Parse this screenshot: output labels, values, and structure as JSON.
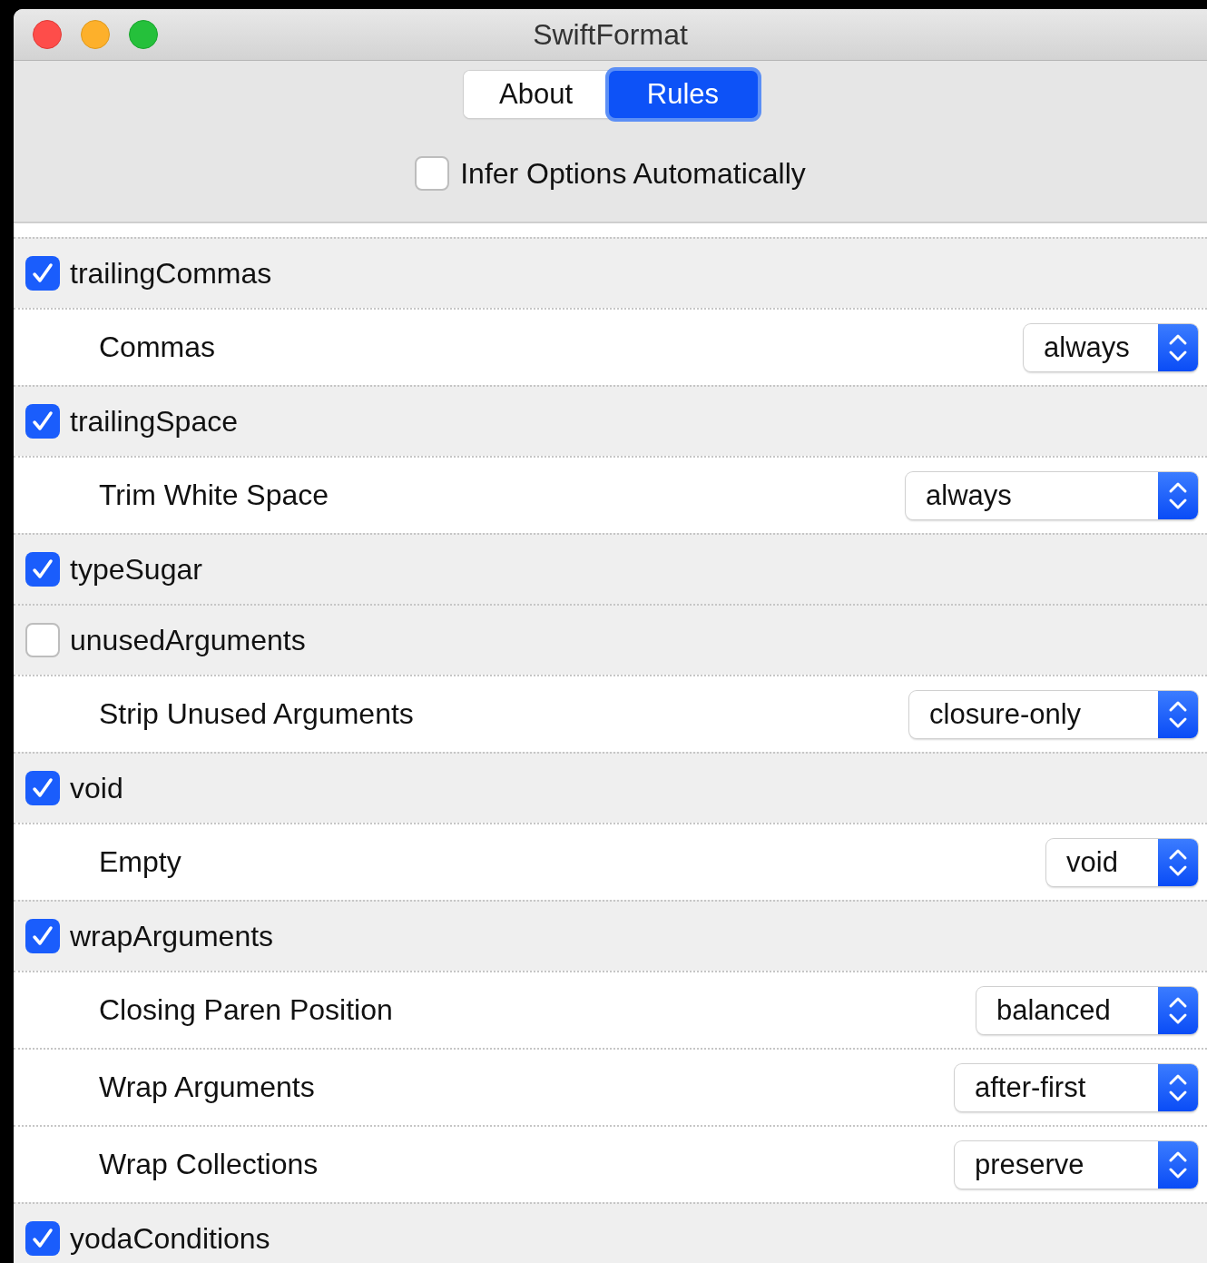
{
  "window": {
    "title": "SwiftFormat"
  },
  "tabs": [
    {
      "label": "About",
      "selected": false
    },
    {
      "label": "Rules",
      "selected": true
    }
  ],
  "infer_option": {
    "label": "Infer Options Automatically",
    "checked": false
  },
  "rules": [
    {
      "name": "trailingCommas",
      "checked": true,
      "options": [
        {
          "label": "Commas",
          "value": "always"
        }
      ]
    },
    {
      "name": "trailingSpace",
      "checked": true,
      "options": [
        {
          "label": "Trim White Space",
          "value": "always"
        }
      ]
    },
    {
      "name": "typeSugar",
      "checked": true
    },
    {
      "name": "unusedArguments",
      "checked": false,
      "options": [
        {
          "label": "Strip Unused Arguments",
          "value": "closure-only"
        }
      ]
    },
    {
      "name": "void",
      "checked": true,
      "options": [
        {
          "label": "Empty",
          "value": "void"
        }
      ]
    },
    {
      "name": "wrapArguments",
      "checked": true,
      "options": [
        {
          "label": "Closing Paren Position",
          "value": "balanced"
        },
        {
          "label": "Wrap Arguments",
          "value": "after-first"
        },
        {
          "label": "Wrap Collections",
          "value": "preserve"
        }
      ]
    },
    {
      "name": "yodaConditions",
      "checked": true
    }
  ]
}
